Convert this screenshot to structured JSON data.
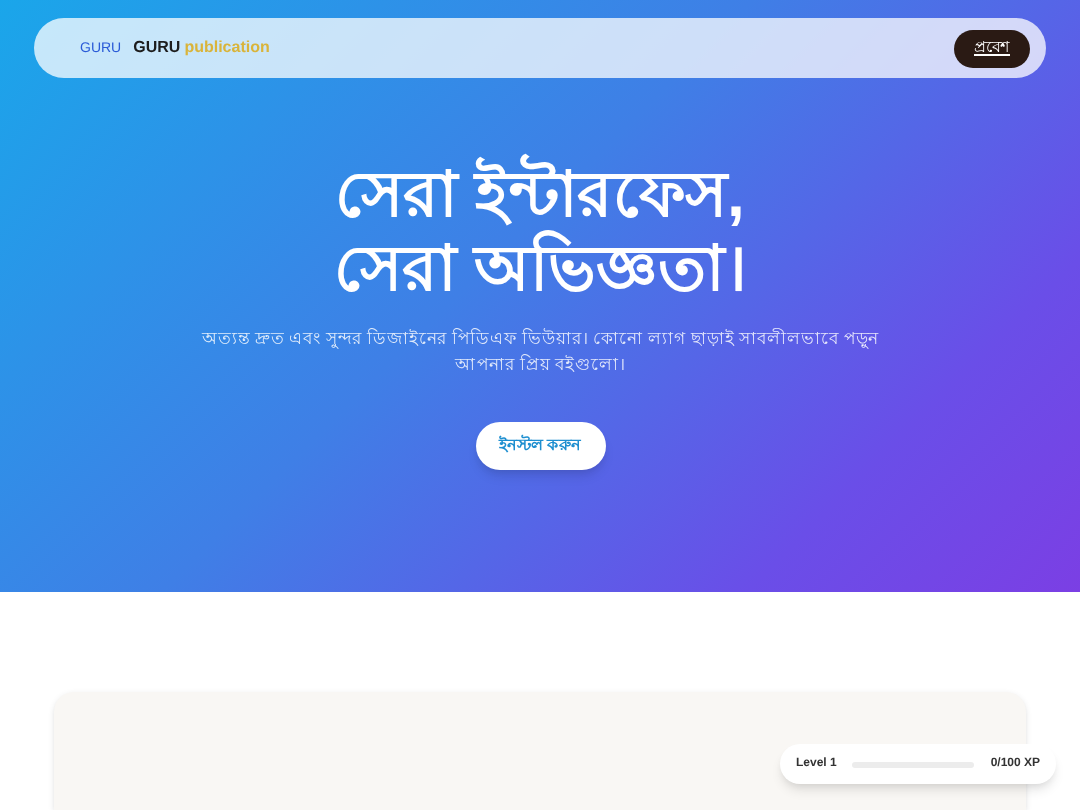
{
  "navbar": {
    "logo_alt": "GURU",
    "brand": "GURU",
    "brand_accent": "publication",
    "button": "প্রবেশ"
  },
  "hero": {
    "title_lines": [
      "সেরা ইন্টারফেস,",
      "সেরা অভিজ্ঞতা।"
    ],
    "subtitle": "অত্যন্ত দ্রুত এবং সুন্দর ডিজাইনের পিডিএফ ভিউয়ার। কোনো ল্যাগ ছাড়াই সাবলীলভাবে পড়ুন আপনার প্রিয় বইগুলো।",
    "button": "ইনস্টল করুন"
  },
  "xp_widget": {
    "label": "Level 1",
    "level": 0,
    "reading": "0/100 XP"
  }
}
